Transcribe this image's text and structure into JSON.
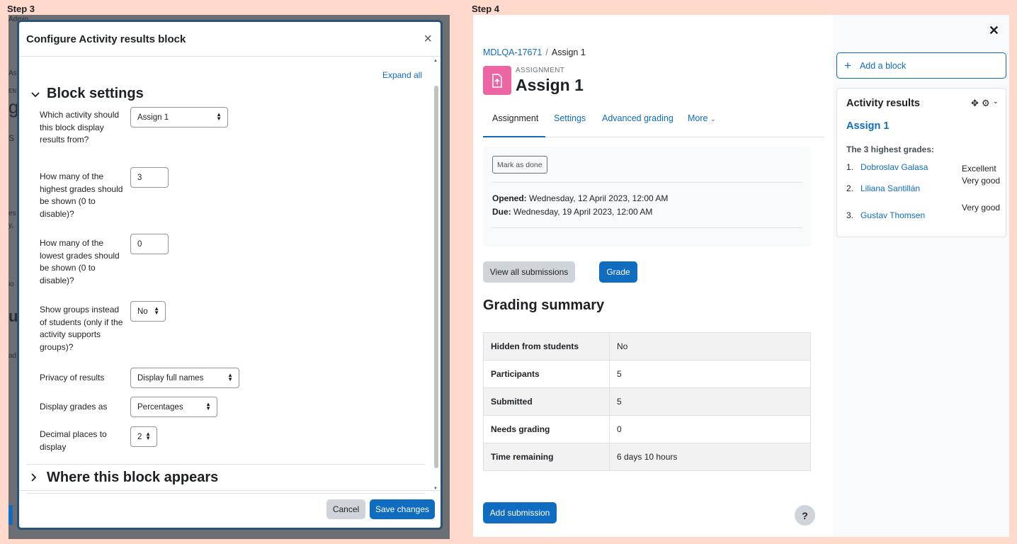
{
  "step3": {
    "label": "Step 3",
    "background_fragments": [
      "Administration",
      "As",
      "EN",
      "g",
      "S",
      "es",
      "y,",
      "io",
      "u",
      "ad"
    ],
    "modal": {
      "title": "Configure Activity results block",
      "expand_all": "Expand all",
      "section_block_settings": "Block settings",
      "section_where": "Where this block appears",
      "fields": {
        "activity": {
          "label": "Which activity should this block display results from?",
          "value": "Assign 1"
        },
        "highest": {
          "label": "How many of the highest grades should be shown (0 to disable)?",
          "value": "3"
        },
        "lowest": {
          "label": "How many of the lowest grades should be shown (0 to disable)?",
          "value": "0"
        },
        "groups": {
          "label": "Show groups instead of students (only if the activity supports groups)?",
          "value": "No"
        },
        "privacy": {
          "label": "Privacy of results",
          "value": "Display full names"
        },
        "display_as": {
          "label": "Display grades as",
          "value": "Percentages"
        },
        "decimals": {
          "label": "Decimal places to display",
          "value": "2"
        }
      },
      "cancel_label": "Cancel",
      "save_label": "Save changes"
    }
  },
  "step4": {
    "label": "Step 4",
    "breadcrumb": {
      "course": "MDLQA-17671",
      "separator": "/",
      "current": "Assign 1"
    },
    "activity": {
      "type": "ASSIGNMENT",
      "name": "Assign 1",
      "icon": "assignment-icon",
      "icon_color": "#eb66a2"
    },
    "tabs": {
      "assignment": "Assignment",
      "settings": "Settings",
      "advanced": "Advanced grading",
      "more": "More"
    },
    "mark_done": "Mark as done",
    "opened": {
      "label": "Opened:",
      "value": "Wednesday, 12 April 2023, 12:00 AM"
    },
    "due": {
      "label": "Due:",
      "value": "Wednesday, 19 April 2023, 12:00 AM"
    },
    "view_all": "View all submissions",
    "grade": "Grade",
    "grading_summary": "Grading summary",
    "summary_rows": [
      {
        "key": "Hidden from students",
        "value": "No"
      },
      {
        "key": "Participants",
        "value": "5"
      },
      {
        "key": "Submitted",
        "value": "5"
      },
      {
        "key": "Needs grading",
        "value": "0"
      },
      {
        "key": "Time remaining",
        "value": "6 days 10 hours"
      }
    ],
    "add_submission": "Add submission",
    "help": "?",
    "drawer": {
      "add_block": "Add a block",
      "block_title": "Activity results",
      "block_activity": "Assign 1",
      "subtitle": "The 3 highest grades:",
      "grades": [
        {
          "rank": "1.",
          "name": "Dobroslav Galasa",
          "value": "Excellent"
        },
        {
          "rank": "2.",
          "name": "Liliana Santillán",
          "value": "Very good"
        },
        {
          "rank": "3.",
          "name": "Gustav Thomsen",
          "value": "Very good"
        }
      ]
    }
  },
  "colors": {
    "primary": "#0f6cbf",
    "secondary_button": "#ced4da",
    "page_background": "#ffd9cc"
  }
}
